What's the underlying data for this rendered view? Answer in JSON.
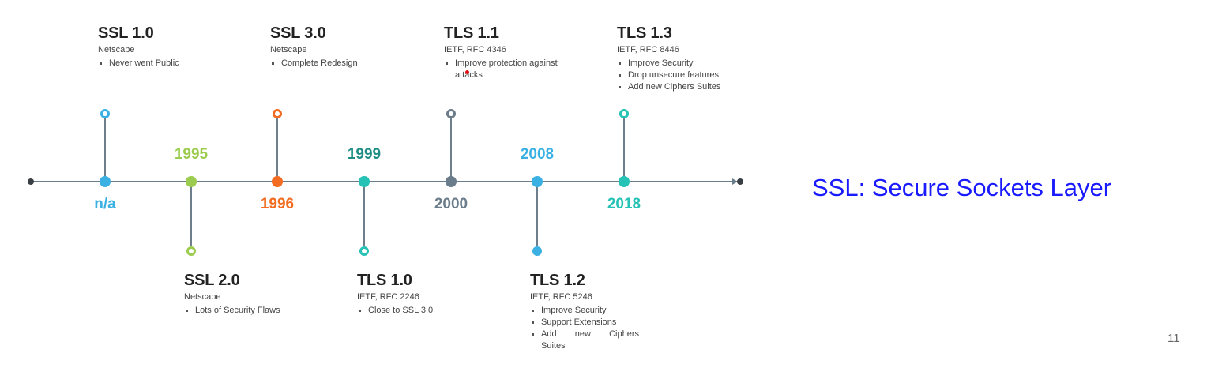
{
  "side_title": "SSL: Secure Sockets Layer",
  "page_number": "11",
  "milestones": [
    {
      "year": "n/a",
      "color": "#3bb1e3",
      "title": "SSL 1.0",
      "org": "Netscape",
      "points": [
        "Never went Public"
      ]
    },
    {
      "year": "1995",
      "color": "#9ccc4f",
      "title": "SSL 2.0",
      "org": "Netscape",
      "points": [
        "Lots of Security Flaws"
      ]
    },
    {
      "year": "1996",
      "color": "#f26c21",
      "title": "SSL 3.0",
      "org": "Netscape",
      "points": [
        "Complete Redesign"
      ]
    },
    {
      "year": "1999",
      "color": "#26c2b5",
      "year_color": "#1e8e85",
      "title": "TLS 1.0",
      "org": "IETF, RFC 2246",
      "points": [
        "Close to SSL 3.0"
      ]
    },
    {
      "year": "2000",
      "color": "#6b7c8b",
      "title": "TLS 1.1",
      "org": "IETF, RFC 4346",
      "points": [
        "Improve protection against attacks"
      ]
    },
    {
      "year": "2008",
      "color": "#3bb1e3",
      "title": "TLS 1.2",
      "org": "IETF, RFC 5246",
      "points": [
        "Improve Security",
        "Support Extensions",
        "Add new Ciphers Suites"
      ]
    },
    {
      "year": "2018",
      "color": "#26c2b5",
      "title": "TLS 1.3",
      "org": "IETF, RFC 8446",
      "points": [
        "Improve Security",
        "Drop unsecure features",
        "Add new Ciphers Suites"
      ]
    }
  ]
}
